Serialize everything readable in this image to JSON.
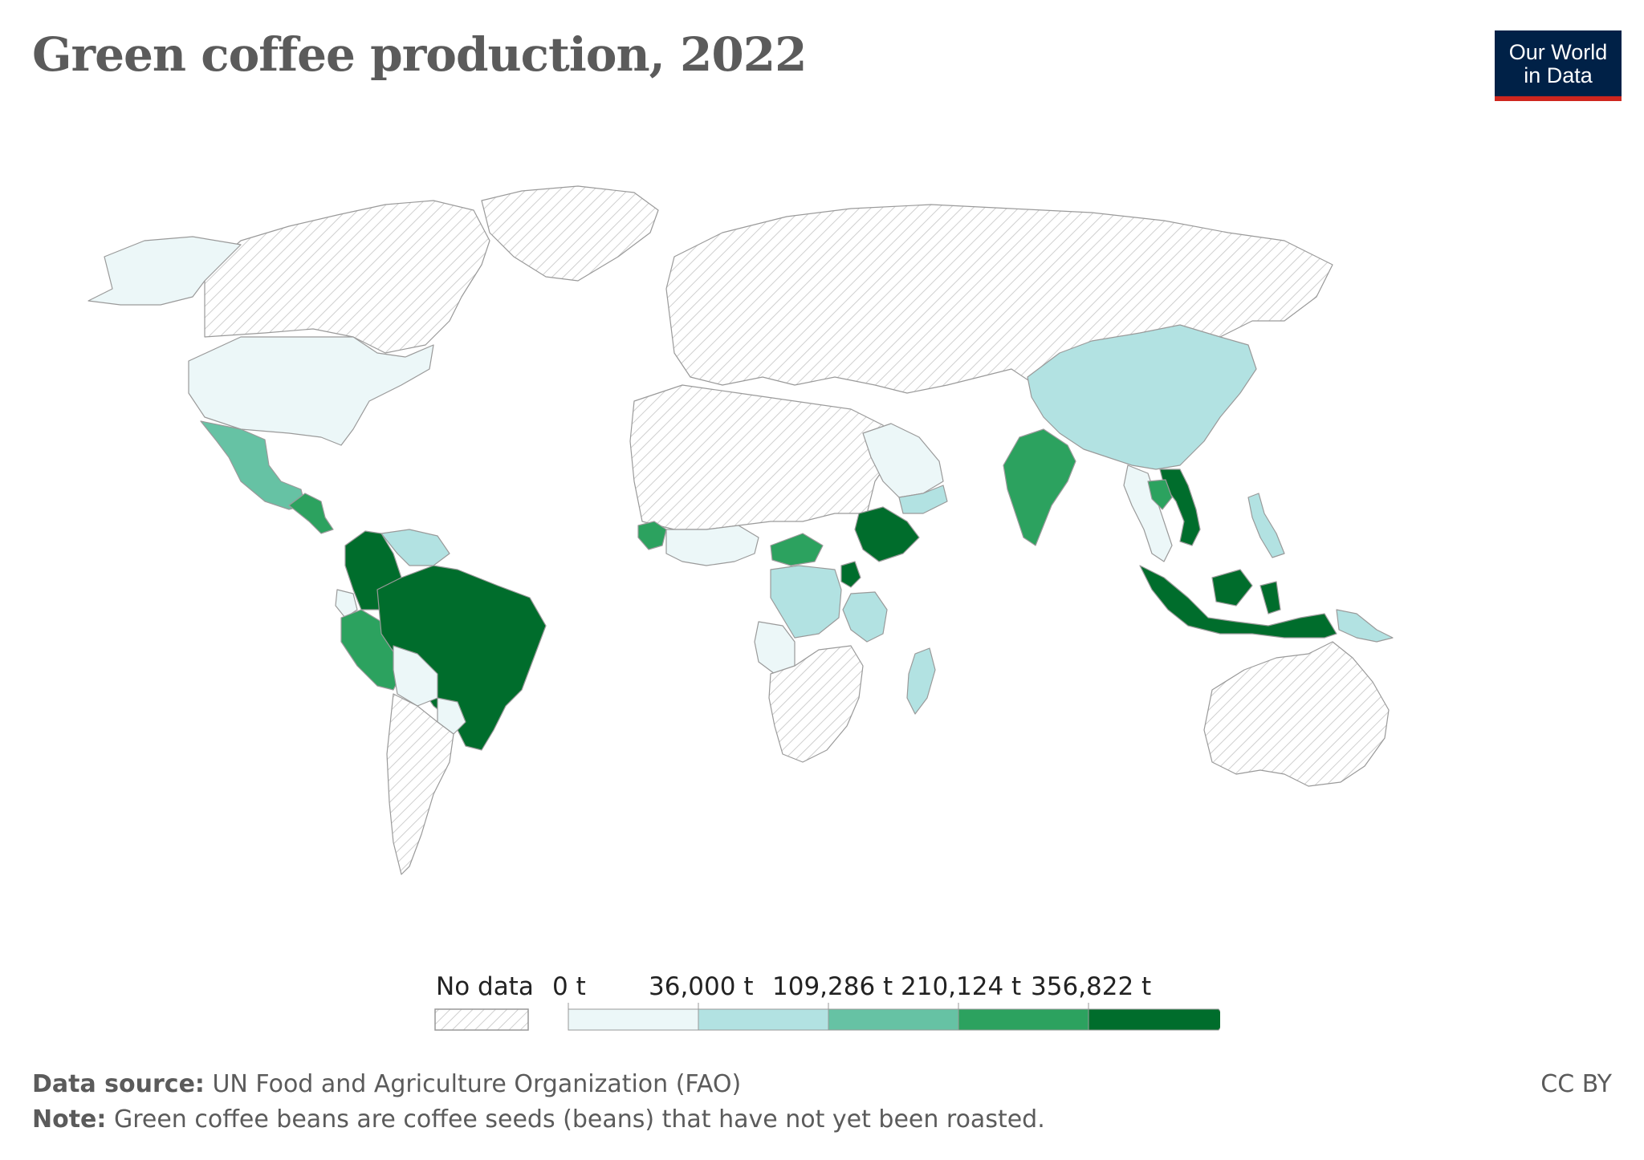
{
  "title": "Green coffee production, 2022",
  "logo": {
    "line1": "Our World",
    "line2": "in Data"
  },
  "colors": {
    "no_data": "#ffffff",
    "bin0": "#ecf7f8",
    "bin1": "#b2e2e2",
    "bin2": "#66c2a4",
    "bin3": "#2ca25f",
    "bin4": "#006d2c",
    "stroke": "#999999",
    "hatch": "#cccccc"
  },
  "legend": {
    "no_data_label": "No data",
    "ticks": [
      "0 t",
      "36,000 t",
      "109,286 t",
      "210,124 t",
      "356,822 t"
    ]
  },
  "footer": {
    "source_label": "Data source:",
    "source_text": "UN Food and Agriculture Organization (FAO)",
    "note_label": "Note:",
    "note_text": "Green coffee beans are coffee seeds (beans) that have not yet been roasted.",
    "license": "CC BY"
  },
  "regions": [
    {
      "name": "Canada",
      "bin": "none"
    },
    {
      "name": "Greenland",
      "bin": "none"
    },
    {
      "name": "Alaska",
      "bin": 0
    },
    {
      "name": "United States",
      "bin": 0
    },
    {
      "name": "Mexico",
      "bin": 2
    },
    {
      "name": "Central America",
      "bin": 3
    },
    {
      "name": "Colombia",
      "bin": 4
    },
    {
      "name": "Venezuela",
      "bin": 1
    },
    {
      "name": "Ecuador",
      "bin": 0
    },
    {
      "name": "Peru",
      "bin": 3
    },
    {
      "name": "Brazil",
      "bin": 4
    },
    {
      "name": "Bolivia",
      "bin": 0
    },
    {
      "name": "Paraguay",
      "bin": 0
    },
    {
      "name": "Argentina/Chile",
      "bin": "none"
    },
    {
      "name": "Europe/Russia",
      "bin": "none"
    },
    {
      "name": "North Africa",
      "bin": "none"
    },
    {
      "name": "Saudi Arabia",
      "bin": 0
    },
    {
      "name": "Yemen",
      "bin": 1
    },
    {
      "name": "Guinea",
      "bin": 3
    },
    {
      "name": "West Africa",
      "bin": 0
    },
    {
      "name": "Central African Republic",
      "bin": 3
    },
    {
      "name": "Ethiopia",
      "bin": 4
    },
    {
      "name": "Uganda",
      "bin": 4
    },
    {
      "name": "DR Congo",
      "bin": 1
    },
    {
      "name": "Tanzania",
      "bin": 1
    },
    {
      "name": "Angola",
      "bin": 0
    },
    {
      "name": "Southern Africa",
      "bin": "none"
    },
    {
      "name": "Madagascar",
      "bin": 1
    },
    {
      "name": "China",
      "bin": 1
    },
    {
      "name": "India",
      "bin": 3
    },
    {
      "name": "Myanmar/Thailand",
      "bin": 0
    },
    {
      "name": "Vietnam",
      "bin": 4
    },
    {
      "name": "Laos",
      "bin": 3
    },
    {
      "name": "Philippines",
      "bin": 1
    },
    {
      "name": "Indonesia",
      "bin": 4
    },
    {
      "name": "Papua New Guinea",
      "bin": 1
    },
    {
      "name": "Australia",
      "bin": "none"
    }
  ]
}
